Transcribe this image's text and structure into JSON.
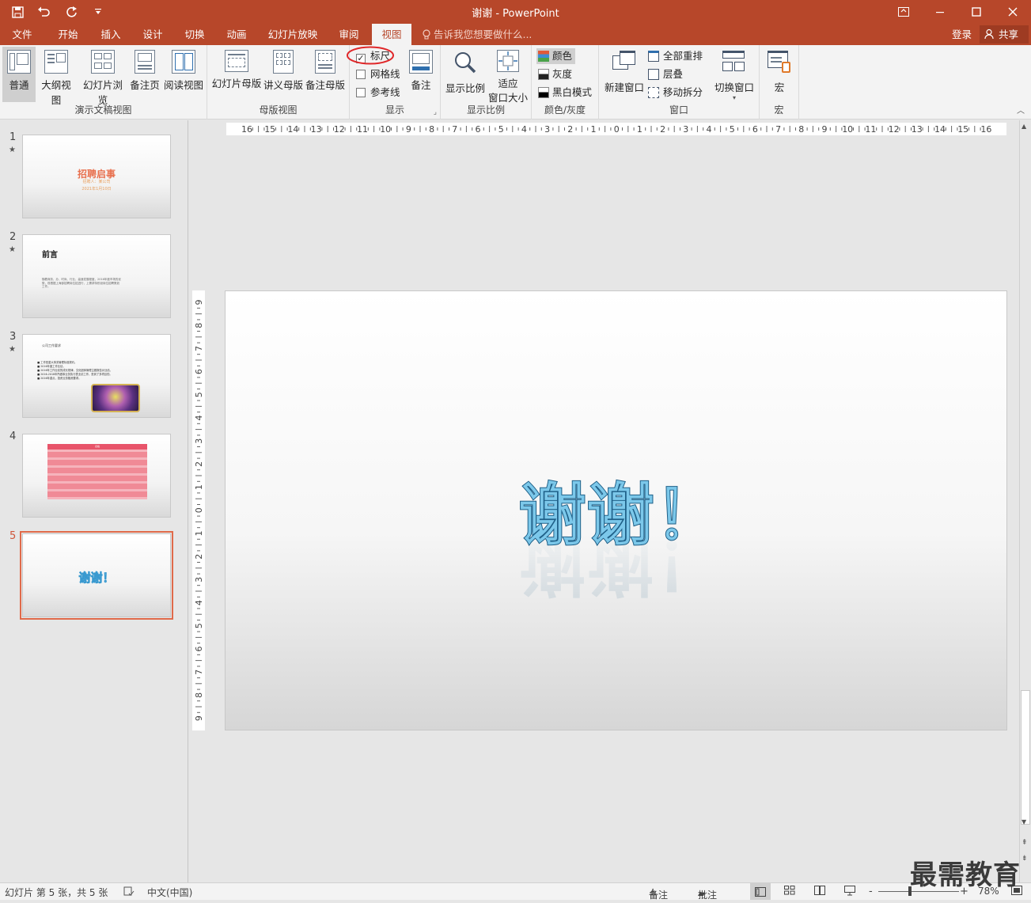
{
  "window": {
    "title": "谢谢 - PowerPoint",
    "qat": {
      "save_icon": "save-icon",
      "undo_icon": "undo-icon",
      "redo_icon": "redo-icon",
      "customize_icon": "customize-icon"
    },
    "controls": {
      "ribbon_display": "ribbon-display-icon",
      "minimize": "minimize-icon",
      "maximize": "maximize-icon",
      "close": "close-icon"
    }
  },
  "tabs": [
    "文件",
    "开始",
    "插入",
    "设计",
    "切换",
    "动画",
    "幻灯片放映",
    "审阅",
    "视图"
  ],
  "active_tab": "视图",
  "tell_me": "告诉我您想要做什么...",
  "login": "登录",
  "share": "共享",
  "ribbon": {
    "presentation_views": {
      "label": "演示文稿视图",
      "buttons": [
        "普通",
        "大纲视图",
        "幻灯片浏览",
        "备注页",
        "阅读视图"
      ]
    },
    "master_views": {
      "label": "母版视图",
      "buttons": [
        "幻灯片母版",
        "讲义母版",
        "备注母版"
      ]
    },
    "show": {
      "label": "显示",
      "ruler": "标尺",
      "ruler_checked": true,
      "gridlines": "网格线",
      "guides": "参考线",
      "notes": "备注"
    },
    "zoom": {
      "label": "显示比例",
      "zoom_btn": "显示比例",
      "fit_line1": "适应",
      "fit_line2": "窗口大小"
    },
    "color": {
      "label": "颜色/灰度",
      "color": "颜色",
      "grayscale": "灰度",
      "bw": "黑白模式"
    },
    "window": {
      "label": "窗口",
      "new_window": "新建窗口",
      "arrange_all": "全部重排",
      "cascade": "层叠",
      "move_split": "移动拆分",
      "switch_windows": "切换窗口"
    },
    "macros": {
      "label": "宏",
      "macros": "宏"
    }
  },
  "ruler": {
    "horizontal": [
      "16",
      "15",
      "14",
      "13",
      "12",
      "11",
      "10",
      "9",
      "8",
      "7",
      "6",
      "5",
      "4",
      "3",
      "2",
      "1",
      "0",
      "1",
      "2",
      "3",
      "4",
      "5",
      "6",
      "7",
      "8",
      "9",
      "10",
      "11",
      "12",
      "13",
      "14",
      "15",
      "16"
    ],
    "vertical": [
      "9",
      "8",
      "7",
      "6",
      "5",
      "4",
      "3",
      "2",
      "1",
      "0",
      "1",
      "2",
      "3",
      "4",
      "5",
      "6",
      "7",
      "8",
      "9"
    ]
  },
  "slides": [
    {
      "num": "1",
      "star": "★",
      "title": "招聘启事",
      "sub1": "招聘人：某公司",
      "sub2": "2021年1月10日"
    },
    {
      "num": "2",
      "star": "★",
      "title": "前言",
      "body": "随着商务、办、时尚、行业、高速发展程度，2016年度市场的优势，现根据上海部招聘岗位招进行，上需求特别设岗位招聘策划工作。"
    },
    {
      "num": "3",
      "star": "★",
      "title": "公司工作要求",
      "bullets": [
        "工作是重大事务管理标准规约。",
        "2016年度工作业绩。",
        "2016年工作业绩的成长规律，文化团体管理主题报告对业绩。",
        "2016-2018年所做事业务执行表业绩工作，是到了多项目的。",
        "2016年重点，投资业务融资要求。"
      ]
    },
    {
      "num": "4",
      "star": "",
      "table_title": "表格"
    },
    {
      "num": "5",
      "star": "",
      "title": "谢谢！"
    }
  ],
  "main_slide_text": "谢谢！",
  "status": {
    "slide_info": "幻灯片 第 5 张，共 5 张",
    "language": "中文(中国)",
    "notes": "备注",
    "comments": "批注",
    "zoom_minus": "-",
    "zoom_plus": "+",
    "zoom_level": "78%",
    "zoom_fraction": 0.78
  },
  "watermark": "最需教育",
  "colors": {
    "accent": "#b7472a",
    "current_slide_border": "#e06a4a",
    "ruler_circle": "#e0282a",
    "text_fill": "#ffffff",
    "text_outline": "#1e5f87"
  }
}
